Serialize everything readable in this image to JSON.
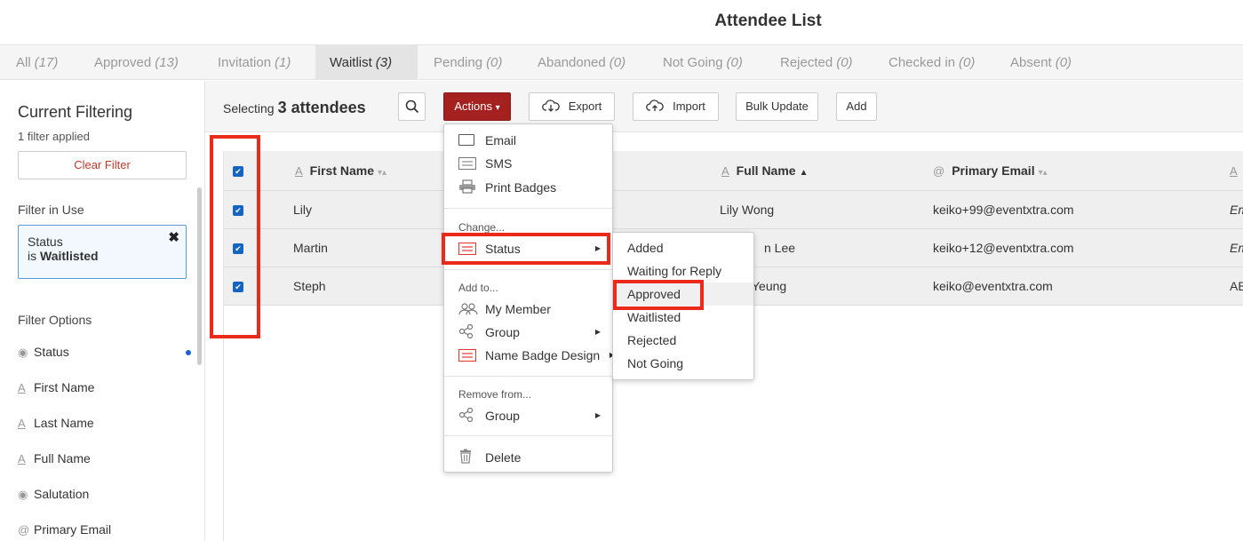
{
  "header": {
    "title": "Attendee List"
  },
  "tabs": [
    {
      "label": "All",
      "count": "(17)"
    },
    {
      "label": "Approved",
      "count": "(13)"
    },
    {
      "label": "Invitation",
      "count": "(1)"
    },
    {
      "label": "Waitlist",
      "count": "(3)",
      "active": true
    },
    {
      "label": "Pending",
      "count": "(0)"
    },
    {
      "label": "Abandoned",
      "count": "(0)"
    },
    {
      "label": "Not Going",
      "count": "(0)"
    },
    {
      "label": "Rejected",
      "count": "(0)"
    },
    {
      "label": "Checked in",
      "count": "(0)"
    },
    {
      "label": "Absent",
      "count": "(0)"
    }
  ],
  "sidebar": {
    "heading": "Current Filtering",
    "applied": "1 filter applied",
    "clear_label": "Clear Filter",
    "filter_in_use_label": "Filter in Use",
    "filter": {
      "field": "Status",
      "prefix": "is",
      "value": "Waitlisted",
      "remove_glyph": "✖"
    },
    "filter_options_label": "Filter Options",
    "options": [
      {
        "label": "Status",
        "icon": "radio-icon",
        "glyph": "◉"
      },
      {
        "label": "First Name",
        "icon": "text-icon",
        "glyph": "A"
      },
      {
        "label": "Last Name",
        "icon": "text-icon",
        "glyph": "A"
      },
      {
        "label": "Full Name",
        "icon": "text-icon",
        "glyph": "A"
      },
      {
        "label": "Salutation",
        "icon": "radio-icon",
        "glyph": "◉"
      },
      {
        "label": "Primary Email",
        "icon": "at-icon",
        "glyph": "@"
      }
    ]
  },
  "toolbar": {
    "selecting_label": "Selecting",
    "selecting_count": "3 attendees",
    "actions_label": "Actions",
    "actions_caret": "▾",
    "export_label": "Export",
    "import_label": "Import",
    "bulk_update_label": "Bulk Update",
    "add_label": "Add"
  },
  "table": {
    "columns": [
      {
        "label": "First Name",
        "icon_glyph": "A",
        "sort": "▾▴"
      },
      {
        "label": "Full Name",
        "icon_glyph": "A",
        "sort": "▲"
      },
      {
        "label": "Primary Email",
        "icon_glyph": "@",
        "sort": "▾▴"
      },
      {
        "label": "",
        "icon_glyph": "A",
        "sort": ""
      }
    ],
    "rows": [
      {
        "first_name": "Lily",
        "full_name": "Lily Wong",
        "email": "keiko+99@eventxtra.com",
        "extra": "Em"
      },
      {
        "first_name": "Martin",
        "full_name": "n Lee",
        "email": "keiko+12@eventxtra.com",
        "extra": "Em"
      },
      {
        "first_name": "Steph",
        "full_name": "Yeung",
        "email": "keiko@eventxtra.com",
        "extra": "AB"
      }
    ],
    "check_glyph": "✔"
  },
  "actions_menu": {
    "email": "Email",
    "sms": "SMS",
    "print_badges": "Print Badges",
    "change_header": "Change...",
    "status": "Status",
    "add_to_header": "Add to...",
    "my_member": "My Member",
    "group": "Group",
    "name_badge_design": "Name Badge Design",
    "remove_from_header": "Remove from...",
    "remove_group": "Group",
    "delete": "Delete",
    "arrow": "▶"
  },
  "status_submenu": [
    "Added",
    "Waiting for Reply",
    "Approved",
    "Waitlisted",
    "Rejected",
    "Not Going"
  ],
  "colors": {
    "actions_button": "#a5211f",
    "highlight_box": "#ea2a1a",
    "checkbox": "#1565c0",
    "filter_border": "#5b9bd5"
  }
}
